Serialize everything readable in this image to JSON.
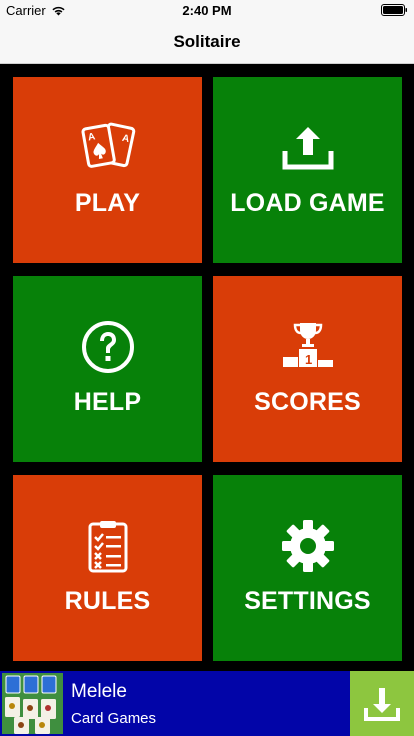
{
  "status_bar": {
    "carrier": "Carrier",
    "time": "2:40 PM",
    "icons": [
      "wifi-icon",
      "battery-icon"
    ]
  },
  "nav": {
    "title": "Solitaire"
  },
  "menu": {
    "play": {
      "label": "PLAY",
      "icon": "playing-cards-icon",
      "color": "#d93d08"
    },
    "load_game": {
      "label": "LOAD GAME",
      "icon": "upload-icon",
      "color": "#078109"
    },
    "help": {
      "label": "HELP",
      "icon": "question-circle-icon",
      "color": "#078109"
    },
    "scores": {
      "label": "SCORES",
      "icon": "trophy-podium-icon",
      "color": "#d93d08"
    },
    "rules": {
      "label": "RULES",
      "icon": "checklist-clipboard-icon",
      "color": "#d93d08"
    },
    "settings": {
      "label": "SETTINGS",
      "icon": "gear-icon",
      "color": "#078109"
    }
  },
  "ad": {
    "title": "Melele",
    "subtitle": "Card Games",
    "icon": "download-icon",
    "background": "#0205a8",
    "button_color": "#8dc63f"
  }
}
